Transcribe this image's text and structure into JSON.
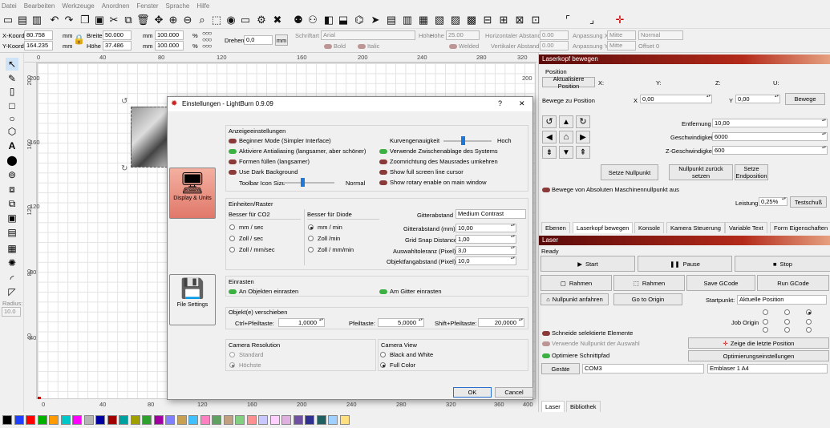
{
  "menu": [
    "Datei",
    "Bearbeiten",
    "Werkzeuge",
    "Anordnen",
    "Fenster",
    "Sprache",
    "Hilfe"
  ],
  "props": {
    "xkoord_label": "X-Koord",
    "xkoord": "80.758",
    "ykoord_label": "Y-Koord",
    "ykoord": "164.235",
    "unit": "mm",
    "breite_label": "Breite",
    "breite": "50.000",
    "hoehe_label": "Höhe",
    "hoehe": "37.486",
    "pct1": "100.000",
    "pct2": "100.000",
    "pct": "%",
    "drehen_label": "Drehen",
    "drehen": "0,0",
    "mm_btn": "mm",
    "schriftart_label": "Schriftart",
    "schriftart": "Arial",
    "hoehe2_label": "Höhe",
    "hoehe2": "25.00",
    "hab_label": "Horizontaler Abstand",
    "hab": "0.00",
    "anpx_label": "Anpassung X",
    "anpx": "Mitte",
    "normal": "Normal",
    "bold": "Bold",
    "italic": "Italic",
    "welded": "Welded",
    "vab_label": "Vertikaler Abstand",
    "vab": "0.00",
    "anpy_label": "Anpassung Y",
    "anpy": "Mitte",
    "offset": "Offset 0"
  },
  "ruler": {
    "top": [
      "0",
      "40",
      "80",
      "120",
      "160",
      "200",
      "240",
      "280",
      "320"
    ],
    "left": [
      "200",
      "160",
      "120",
      "80",
      "40"
    ],
    "bottom": [
      "0",
      "40",
      "80",
      "120",
      "160",
      "200",
      "240",
      "280",
      "320",
      "360",
      "400"
    ],
    "right": "200",
    "radius_label": "Radius:",
    "radius": "10.0"
  },
  "laser_head": {
    "title": "Laserkopf bewegen",
    "position": "Position",
    "refresh": "Aktualisiere Position",
    "x": "X:",
    "y": "Y:",
    "z": "Z:",
    "u": "U:",
    "moveto": "Bewege zu Position",
    "mx": "X",
    "mxv": "0,00",
    "my": "Y",
    "myv": "0,00",
    "move_btn": "Bewege",
    "dist_label": "Entfernung",
    "dist": "10,00",
    "speed_label": "Geschwindigkeit",
    "speed": "6000",
    "zspeed_label": "Z-Geschwindigkeit",
    "zspeed": "600",
    "set_origin": "Setze Nullpunkt",
    "reset_origin": "Nullpunkt zurück setzen",
    "set_end": "Setze Endposition",
    "abs_toggle": "Bewege von Absoluten Maschinennullpunkt aus",
    "power_label": "Leistung",
    "power": "0,25%",
    "test": "Testschuß"
  },
  "tabs": [
    "Ebenen",
    "Laserkopf bewegen",
    "Konsole",
    "Kamera Steuerung",
    "Variable Text",
    "Form Eigenschaften"
  ],
  "laser": {
    "title": "Laser",
    "status": "Ready",
    "start": "Start",
    "pause": "Pause",
    "stop": "Stop",
    "frame1": "Rahmen",
    "frame2": "Rahmen",
    "save": "Save GCode",
    "run": "Run GCode",
    "home": "Nullpunkt anfahren",
    "goorigin": "Go to Origin",
    "startpoint_label": "Startpunkt:",
    "startpoint": "Aktuelle Position",
    "joborigin": "Job Origin",
    "cut_sel": "Schneide selektierte Elemente",
    "use_sel_origin": "Verwende Nullpunkt der Auswahl",
    "show_pos": "Zeige die letzte Position",
    "optimize": "Optimiere Schnittpfad",
    "opt_settings": "Optimierungseinstellungen",
    "devices": "Geräte",
    "port": "COM3",
    "device": "Emblaser 1 A4"
  },
  "bottom_tabs": [
    "Laser",
    "Bibliothek"
  ],
  "dialog": {
    "title": "Einstellungen - LightBurn 0.9.09",
    "help": "?",
    "close": "✕",
    "side": [
      {
        "label": "Display & Units"
      },
      {
        "label": "File Settings"
      }
    ],
    "display": {
      "title": "Anzeigeeinstellungen",
      "beginner": "Beginner Mode (Simpler Interface)",
      "aa": "Aktiviere Antialiasing (langsamer, aber schöner)",
      "fill": "Formen füllen (langsamer)",
      "dark": "Use Dark Background",
      "iconsize": "Toolbar Icon Size",
      "normal": "Normal",
      "curve": "Kurvengenauigkeit",
      "hoch": "Hoch",
      "clip": "Verwende Zwischenablage des Systems",
      "zoom": "Zoomrichtung des Mausrades umkehren",
      "cursor": "Show full screen line cursor",
      "rotary": "Show rotary enable on main window"
    },
    "units": {
      "title": "Einheiten/Raster",
      "co2": "Besser für CO2",
      "diode": "Besser für Diode",
      "co2opts": [
        "mm / sec",
        "Zoll / sec",
        "Zoll / mm/sec"
      ],
      "diodeopts": [
        "mm / min",
        "Zoll /min",
        "Zoll / mm/min"
      ],
      "grid_label": "Gitterabstand",
      "grid": "Medium Contrast",
      "gridmm_label": "Gitterabstand (mm)",
      "gridmm": "10,00",
      "snap_label": "Grid Snap Distance",
      "snap": "1,00",
      "tol_label": "Auswahltoleranz (Pixel)",
      "tol": "3,0",
      "objsnap_label": "Objektfangabstand (Pixel)",
      "objsnap": "10,0"
    },
    "snap": {
      "title": "Einrasten",
      "objects": "An Objekten einrasten",
      "grid": "Am Gitter einrasten"
    },
    "move": {
      "title": "Objekt(e) verschieben",
      "ctrl_label": "Ctrl+Pfeiltaste:",
      "ctrl": "1,0000",
      "arrow_label": "Pfeiltaste:",
      "arrow": "5,0000",
      "shift_label": "Shift+Pfeiltaste:",
      "shift": "20,0000"
    },
    "camres": {
      "title": "Camera Resolution",
      "std": "Standard",
      "high": "Höchste"
    },
    "camview": {
      "title": "Camera View",
      "bw": "Black and White",
      "fc": "Full Color"
    },
    "ok": "OK",
    "cancel": "Cancel"
  },
  "palette": [
    "#000000",
    "#1f3fff",
    "#ff0000",
    "#00b000",
    "#ff9a00",
    "#00c8c8",
    "#ff00ff",
    "#b4b4b4",
    "#0000a0",
    "#a00000",
    "#00a0a0",
    "#a0a000",
    "#2ea02e",
    "#a000a0",
    "#8080ff",
    "#c8a050",
    "#40c0ff",
    "#ff80c0",
    "#60a060",
    "#c0a080",
    "#80d080",
    "#ff9090",
    "#c8c8ff",
    "#ffd0ff",
    "#e0b0e0",
    "#7050a0",
    "#303090",
    "#206060",
    "#a0d0ff",
    "#ffe080"
  ]
}
